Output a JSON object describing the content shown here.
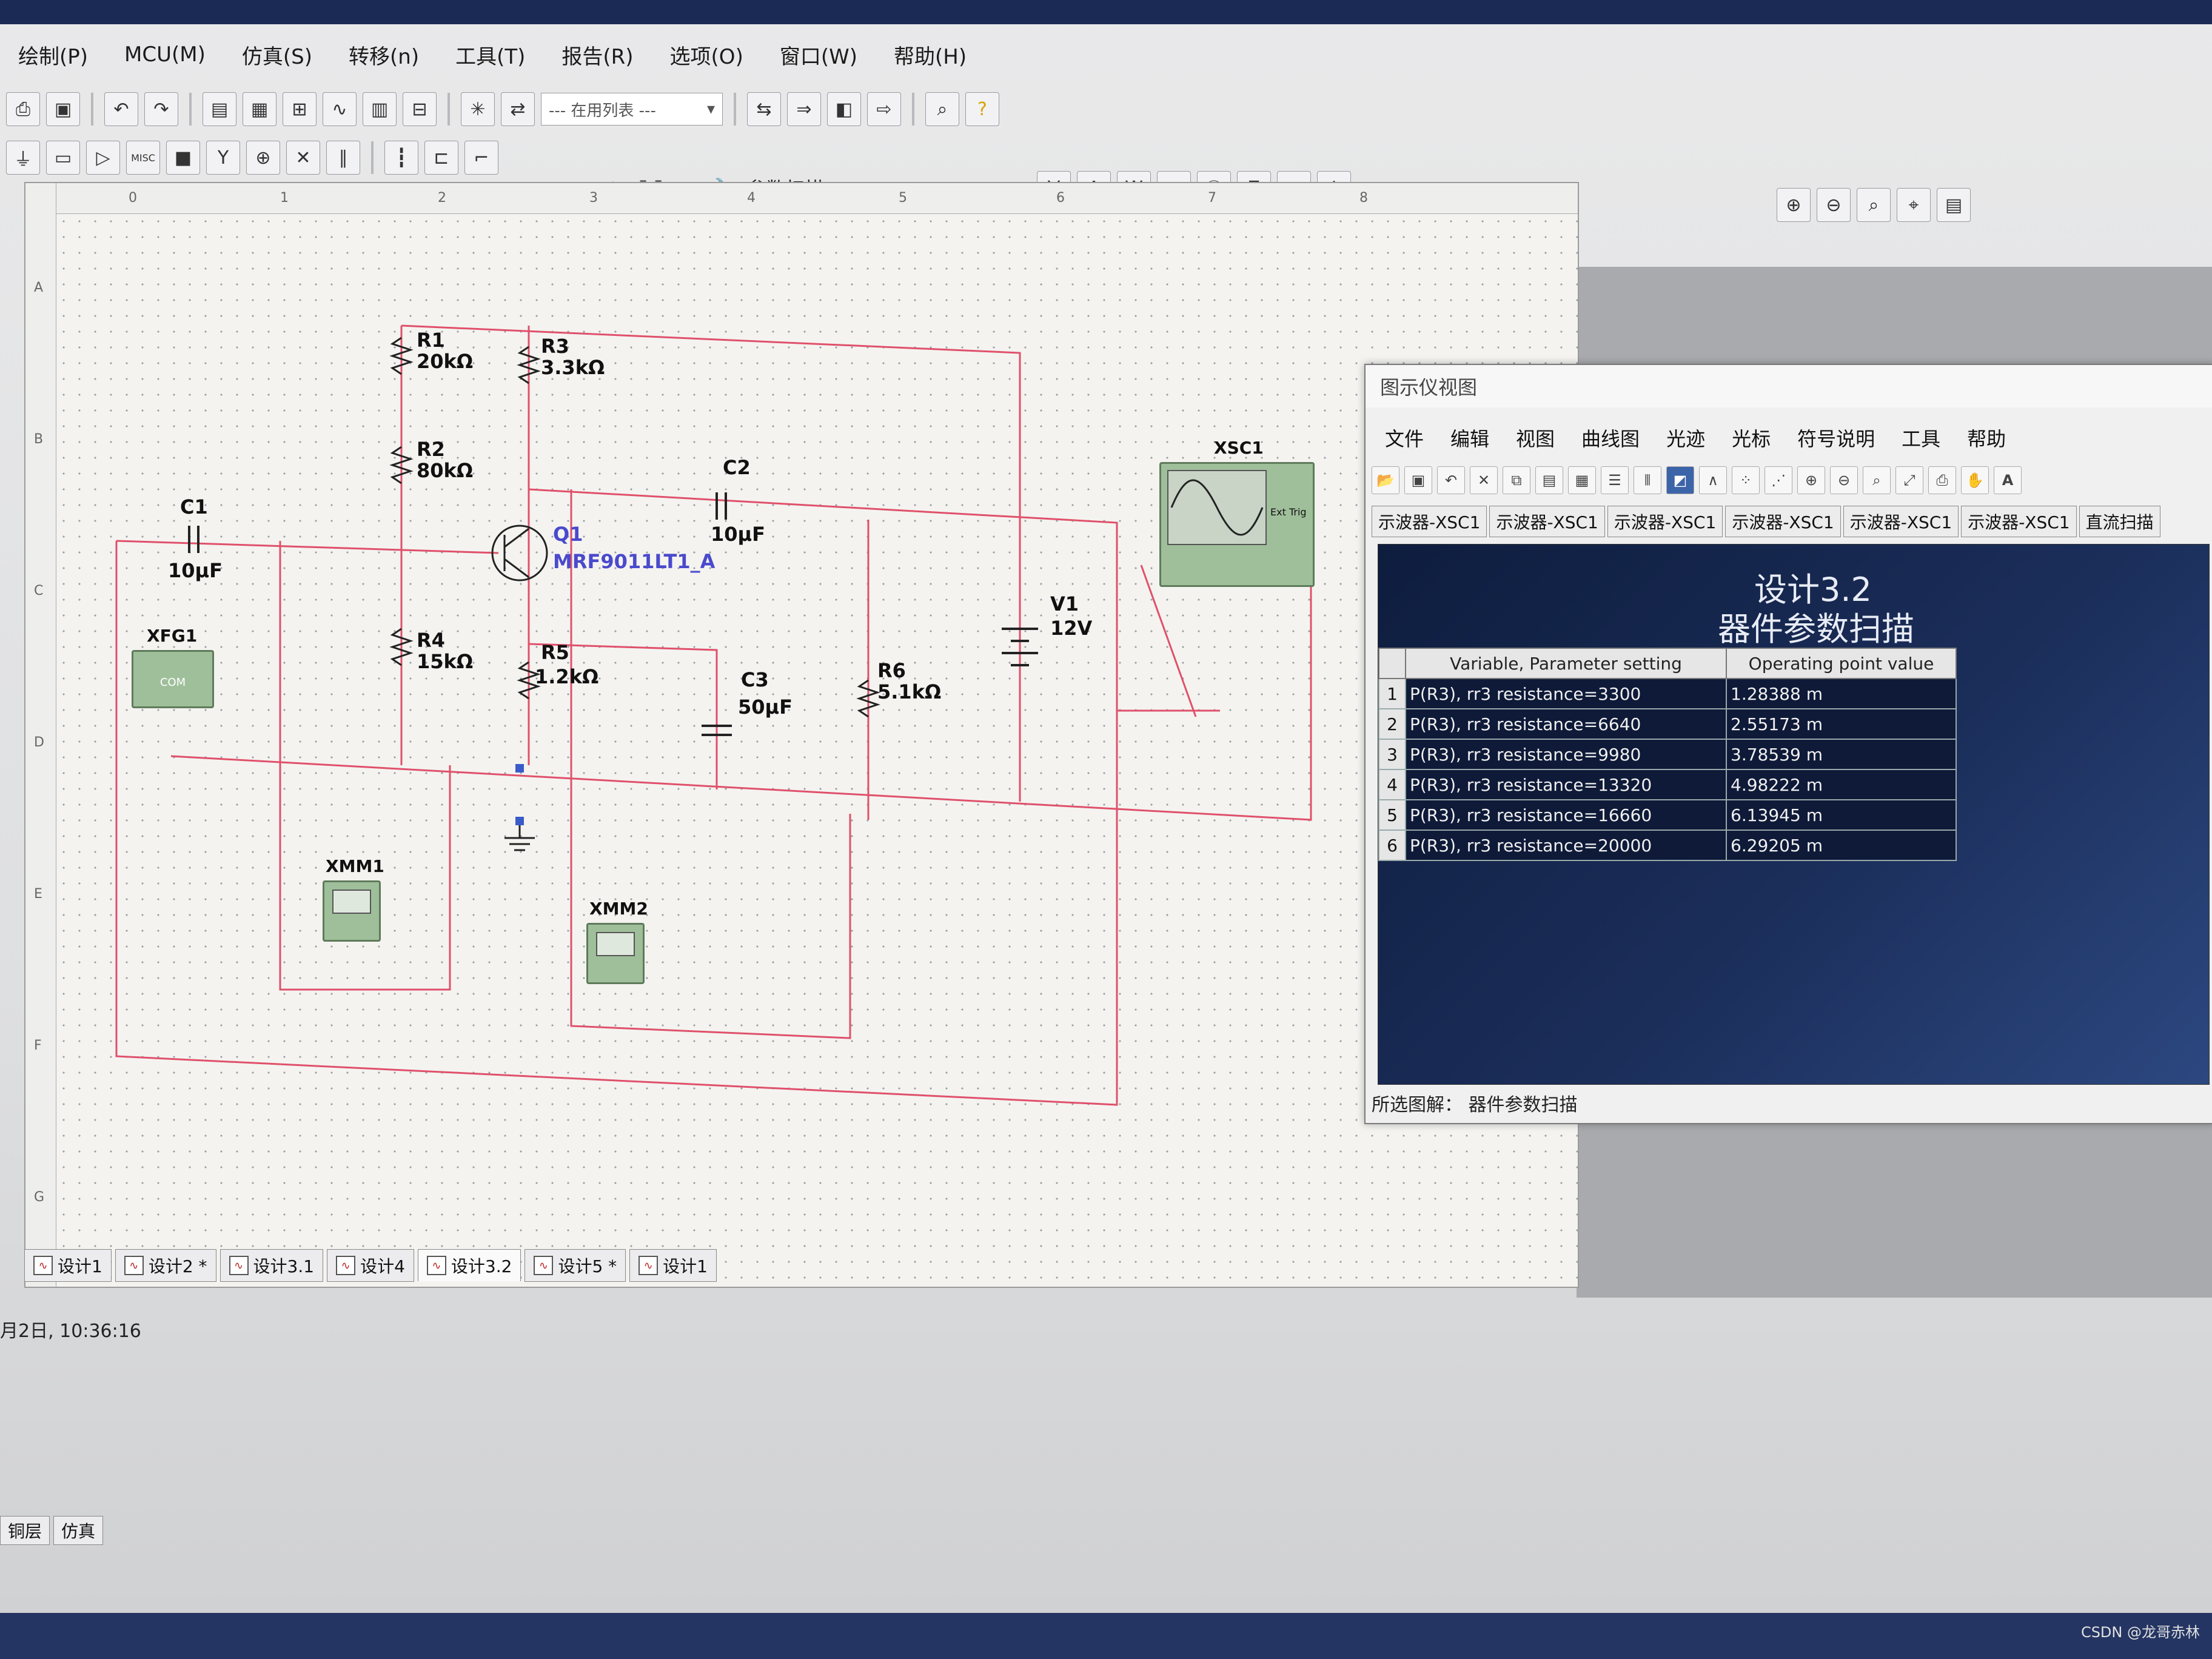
{
  "menu": [
    "绘制(P)",
    "MCU(M)",
    "仿真(S)",
    "转移(n)",
    "工具(T)",
    "报告(R)",
    "选项(O)",
    "窗口(W)",
    "帮助(H)"
  ],
  "toolbar": {
    "in_use_list": "--- 在用列表 ---",
    "param_sweep_label": "参数扫描...",
    "misc": "MISC"
  },
  "schematic": {
    "components": {
      "R1": {
        "label": "R1",
        "value": "20kΩ"
      },
      "R2": {
        "label": "R2",
        "value": "80kΩ"
      },
      "R3": {
        "label": "R3",
        "value": "3.3kΩ"
      },
      "R4": {
        "label": "R4",
        "value": "15kΩ"
      },
      "R5": {
        "label": "R5",
        "value": "1.2kΩ"
      },
      "R6": {
        "label": "R6",
        "value": "5.1kΩ"
      },
      "C1": {
        "label": "C1",
        "value": "10μF"
      },
      "C2": {
        "label": "C2",
        "value": "10μF"
      },
      "C3": {
        "label": "C3",
        "value": "50μF"
      },
      "V1": {
        "label": "V1",
        "value": "12V"
      },
      "Q1": {
        "label": "Q1",
        "value": "MRF9011LT1_A"
      }
    },
    "instruments": {
      "XFG1": "XFG1",
      "XMM1": "XMM1",
      "XMM2": "XMM2",
      "XSC1": "XSC1",
      "ext_trig": "Ext Trig",
      "com": "COM"
    },
    "ruler_cols": [
      "0",
      "1",
      "2",
      "3",
      "4",
      "5",
      "6",
      "7",
      "8"
    ],
    "ruler_rows": [
      "A",
      "B",
      "C",
      "D",
      "E",
      "F",
      "G"
    ]
  },
  "design_tabs": [
    "设计1",
    "设计2 *",
    "设计3.1",
    "设计4",
    "设计3.2",
    "设计5 *",
    "设计1"
  ],
  "active_tab_index": 4,
  "status_time": "月2日, 10:36:16",
  "bottom_tabs": [
    "铜层",
    "仿真"
  ],
  "grapher": {
    "title": "图示仪视图",
    "menu": [
      "文件",
      "编辑",
      "视图",
      "曲线图",
      "光迹",
      "光标",
      "符号说明",
      "工具",
      "帮助"
    ],
    "tabs": [
      "示波器-XSC1",
      "示波器-XSC1",
      "示波器-XSC1",
      "示波器-XSC1",
      "示波器-XSC1",
      "示波器-XSC1",
      "直流扫描"
    ],
    "plot_title": "设计3.2",
    "plot_subtitle": "器件参数扫描",
    "table": {
      "headers": [
        "Variable, Parameter setting",
        "Operating point value"
      ],
      "rows": [
        {
          "idx": "1",
          "var": "P(R3), rr3 resistance=3300",
          "val": "1.28388 m"
        },
        {
          "idx": "2",
          "var": "P(R3), rr3 resistance=6640",
          "val": "2.55173 m"
        },
        {
          "idx": "3",
          "var": "P(R3), rr3 resistance=9980",
          "val": "3.78539 m"
        },
        {
          "idx": "4",
          "var": "P(R3), rr3 resistance=13320",
          "val": "4.98222 m"
        },
        {
          "idx": "5",
          "var": "P(R3), rr3 resistance=16660",
          "val": "6.13945 m"
        },
        {
          "idx": "6",
          "var": "P(R3), rr3 resistance=20000",
          "val": "6.29205 m"
        }
      ]
    },
    "status_label": "所选图解：",
    "status_value": "器件参数扫描"
  },
  "colors": {
    "wire": "#e0506a",
    "grapher_bg": "#14254a",
    "instrument": "#9fbf9a"
  },
  "watermark": "CSDN @龙哥赤林"
}
